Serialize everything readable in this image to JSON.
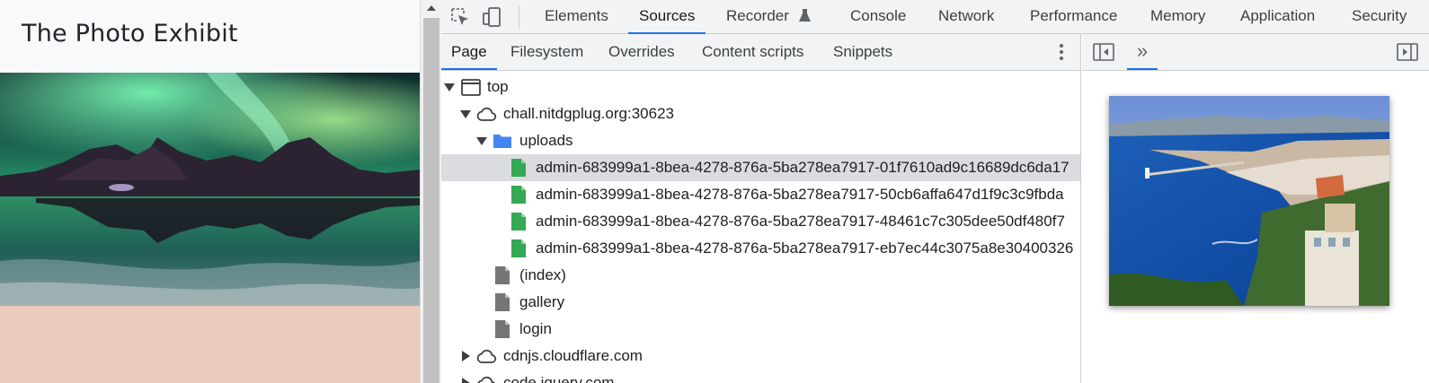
{
  "page": {
    "title": "The Photo Exhibit",
    "hero_image": "aurora-over-mountains-photo",
    "background_color": "#ecccbc"
  },
  "devtools": {
    "main_tabs": [
      "Elements",
      "Sources",
      "Recorder",
      "Console",
      "Network",
      "Performance",
      "Memory",
      "Application",
      "Security"
    ],
    "active_main_tab": "Sources",
    "sub_tabs": [
      "Page",
      "Filesystem",
      "Overrides",
      "Content scripts",
      "Snippets"
    ],
    "active_sub_tab": "Page",
    "tree": [
      {
        "label": "top",
        "type": "frame",
        "expanded": true,
        "depth": 0
      },
      {
        "label": "chall.nitdgplug.org:30623",
        "type": "origin",
        "expanded": true,
        "depth": 1
      },
      {
        "label": "uploads",
        "type": "folder",
        "expanded": true,
        "depth": 2
      },
      {
        "label": "admin-683999a1-8bea-4278-876a-5ba278ea7917-01f7610ad9c16689dc6da17",
        "type": "image-file",
        "depth": 3,
        "selected": true
      },
      {
        "label": "admin-683999a1-8bea-4278-876a-5ba278ea7917-50cb6affa647d1f9c3c9fbda",
        "type": "image-file",
        "depth": 3
      },
      {
        "label": "admin-683999a1-8bea-4278-876a-5ba278ea7917-48461c7c305dee50df480f7",
        "type": "image-file",
        "depth": 3
      },
      {
        "label": "admin-683999a1-8bea-4278-876a-5ba278ea7917-eb7ec44c3075a8e30400326",
        "type": "image-file",
        "depth": 3
      },
      {
        "label": "(index)",
        "type": "file",
        "depth": 2
      },
      {
        "label": "gallery",
        "type": "file",
        "depth": 2
      },
      {
        "label": "login",
        "type": "file",
        "depth": 2
      },
      {
        "label": "cdnjs.cloudflare.com",
        "type": "origin",
        "expanded": false,
        "depth": 1
      },
      {
        "label": "code.jquery.com",
        "type": "origin",
        "expanded": false,
        "depth": 1
      }
    ],
    "preview_image": "coastal-city-harbor-photo",
    "colors": {
      "accent": "#1a73e8",
      "image_file": "#34a853",
      "folder": "#4285f4",
      "selected_row": "#dadce0"
    }
  }
}
